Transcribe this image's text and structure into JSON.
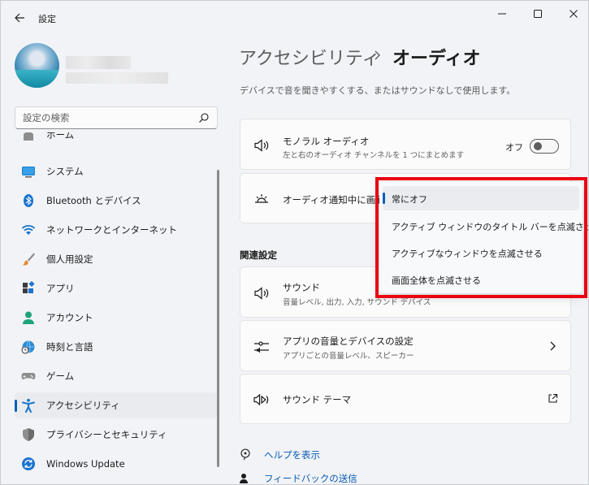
{
  "window": {
    "title": "設定"
  },
  "search": {
    "placeholder": "設定の検索"
  },
  "sidebar": {
    "items": [
      {
        "label": "ホーム",
        "icon": "home-icon"
      },
      {
        "label": "システム",
        "icon": "system-icon"
      },
      {
        "label": "Bluetooth とデバイス",
        "icon": "bluetooth-icon"
      },
      {
        "label": "ネットワークとインターネット",
        "icon": "wifi-icon"
      },
      {
        "label": "個人用設定",
        "icon": "brush-icon"
      },
      {
        "label": "アプリ",
        "icon": "apps-icon"
      },
      {
        "label": "アカウント",
        "icon": "account-icon"
      },
      {
        "label": "時刻と言語",
        "icon": "time-language-icon"
      },
      {
        "label": "ゲーム",
        "icon": "gamepad-icon"
      },
      {
        "label": "アクセシビリティ",
        "icon": "accessibility-icon",
        "active": true
      },
      {
        "label": "プライバシーとセキュリティ",
        "icon": "shield-icon"
      },
      {
        "label": "Windows Update",
        "icon": "windows-update-icon"
      }
    ]
  },
  "breadcrumb": {
    "parent": "アクセシビリティ",
    "current": "オーディオ"
  },
  "page": {
    "description": "デバイスで音を聞きやすくする、またはサウンドなしで使用します。"
  },
  "mono_audio": {
    "title": "モノラル オーディオ",
    "subtitle": "左と右のオーディオ チャンネルを 1 つにまとめます",
    "toggle_label": "オフ",
    "toggle_on": false
  },
  "flash_card": {
    "title": "オーディオ通知中に画面"
  },
  "related": {
    "heading": "関連設定",
    "sound": {
      "title": "サウンド",
      "subtitle": "音量レベル, 出力, 入力, サウンド デバイス"
    },
    "app_volume": {
      "title": "アプリの音量とデバイスの設定",
      "subtitle": "アプリごとの音量レベル、スピーカー"
    },
    "sound_theme": {
      "title": "サウンド テーマ"
    }
  },
  "links": {
    "help": "ヘルプを表示",
    "feedback": "フィードバックの送信"
  },
  "dropdown": {
    "options": [
      "常にオフ",
      "アクティブ ウィンドウのタイトル バーを点滅させる",
      "アクティブなウィンドウを点滅させる",
      "画面全体を点滅させる"
    ],
    "selected_index": 0
  },
  "colors": {
    "accent": "#005fb8",
    "highlight_frame": "#ea0012",
    "link": "#0a5bb5"
  }
}
